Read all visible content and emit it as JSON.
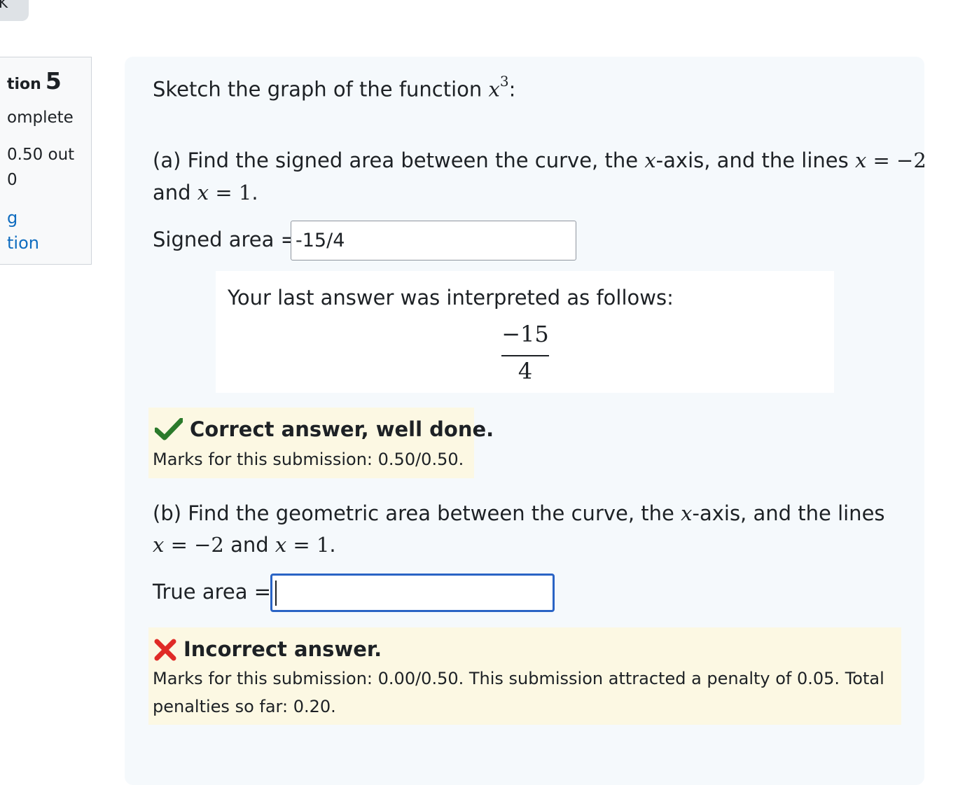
{
  "nav": {
    "back_button_label": "K"
  },
  "question_info": {
    "title_label": "tion",
    "number": "5",
    "status": "omplete",
    "mark_line1": "0.50 out",
    "mark_line2": "0",
    "flag_line1": "g",
    "flag_line2": "tion"
  },
  "question": {
    "intro": "Sketch the graph of the function",
    "intro_var": "x",
    "intro_exp": "3",
    "intro_end": ":",
    "part_a": {
      "text_1": "(a) Find the signed area between the curve, the ",
      "var_x": "x",
      "text_2": "-axis, and the lines ",
      "eq_1_var": "x",
      "eq_1_rest": " = −2",
      "text_3": "and ",
      "eq_2_var": "x",
      "eq_2_rest": " = 1",
      "text_4": ".",
      "input_label": "Signed area =",
      "input_value": "-15/4"
    },
    "validation": {
      "text": "Your last answer was interpreted as follows:",
      "numerator": "−15",
      "denominator": "4"
    },
    "feedback_a": {
      "title": "Correct answer, well done.",
      "marks": "Marks for this submission: 0.50/0.50."
    },
    "part_b": {
      "text_1": "(b) Find the geometric area between the curve, the ",
      "var_x": "x",
      "text_2": "-axis, and the lines",
      "eq_1_var": "x",
      "eq_1_rest": " = −2",
      "text_3": " and ",
      "eq_2_var": "x",
      "eq_2_rest": " = 1",
      "text_4": ".",
      "input_label": "True area =",
      "input_value": ""
    },
    "feedback_b": {
      "title": "Incorrect answer.",
      "marks_line1": "Marks for this submission: 0.00/0.50. This submission attracted a penalty of 0.05. Total",
      "marks_line2": "penalties so far: 0.20."
    }
  },
  "colors": {
    "correct": "#2b7a2b",
    "incorrect": "#e02b27",
    "link": "#0f6cbf",
    "focus_border": "#2a64c5"
  }
}
